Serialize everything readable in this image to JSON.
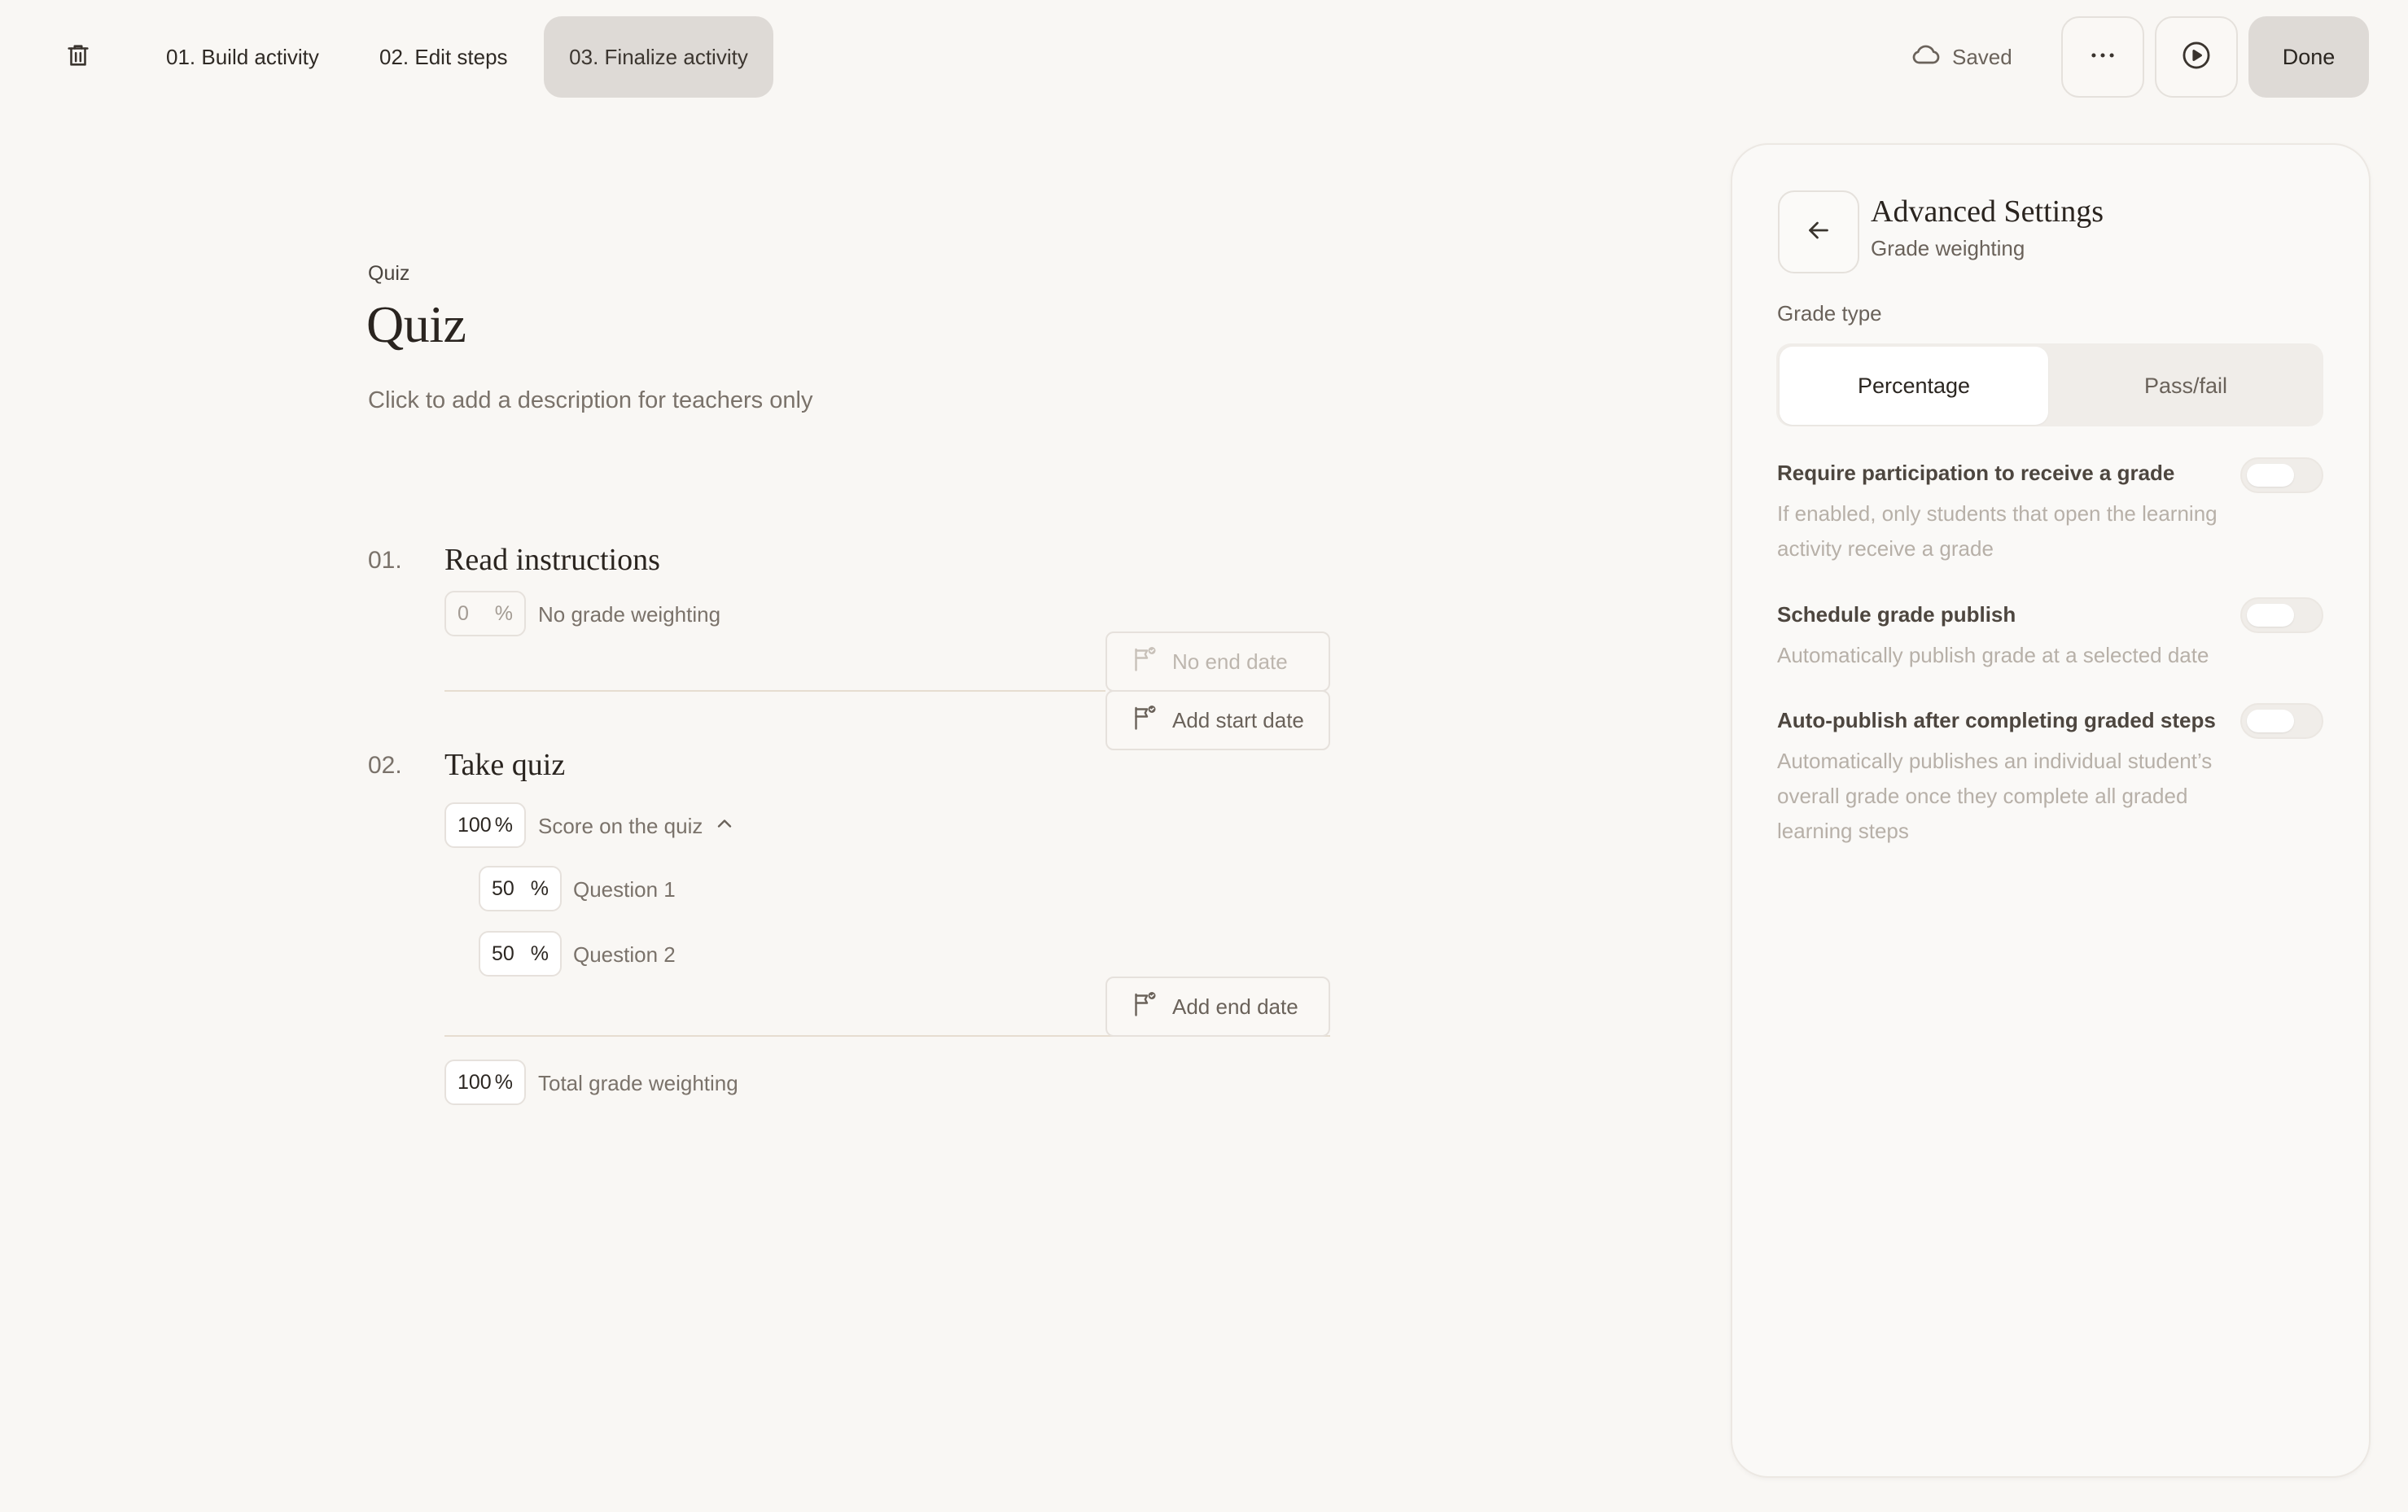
{
  "header": {
    "trash_icon": "trash-icon",
    "steps": [
      {
        "label": "01. Build activity"
      },
      {
        "label": "02. Edit steps"
      },
      {
        "label": "03. Finalize activity"
      }
    ],
    "saved_label": "Saved",
    "done_label": "Done",
    "more_icon": "more-horizontal-icon",
    "play_icon": "play-circle-icon"
  },
  "activity": {
    "kind": "Quiz",
    "title": "Quiz",
    "description_placeholder": "Click to add a description for teachers only"
  },
  "steps": [
    {
      "number": "01.",
      "title": "Read instructions",
      "weight_value": "0",
      "weight_unit": "%",
      "weight_label": "No grade weighting",
      "end_date_label": "No end date",
      "start_date_label": "Add start date"
    },
    {
      "number": "02.",
      "title": "Take quiz",
      "weight_value": "100",
      "weight_unit": "%",
      "weight_label": "Score on the quiz",
      "questions": [
        {
          "value": "50",
          "unit": "%",
          "label": "Question 1"
        },
        {
          "value": "50",
          "unit": "%",
          "label": "Question 2"
        }
      ],
      "end_date_label": "Add end date"
    }
  ],
  "total": {
    "value": "100",
    "unit": "%",
    "label": "Total grade weighting"
  },
  "panel": {
    "title": "Advanced Settings",
    "subtitle": "Grade weighting",
    "grade_type_label": "Grade type",
    "grade_type_options": [
      "Percentage",
      "Pass/fail"
    ],
    "grade_type_selected": "Percentage",
    "settings": [
      {
        "title": "Require participation to receive a grade",
        "description": "If enabled, only students that open the learning activity receive a grade",
        "enabled": false
      },
      {
        "title": "Schedule grade publish",
        "description": "Automatically publish grade at a selected date",
        "enabled": false
      },
      {
        "title": "Auto-publish after completing graded steps",
        "description": "Automatically publishes an individual student’s overall grade once they complete all graded learning steps",
        "enabled": false
      }
    ]
  }
}
